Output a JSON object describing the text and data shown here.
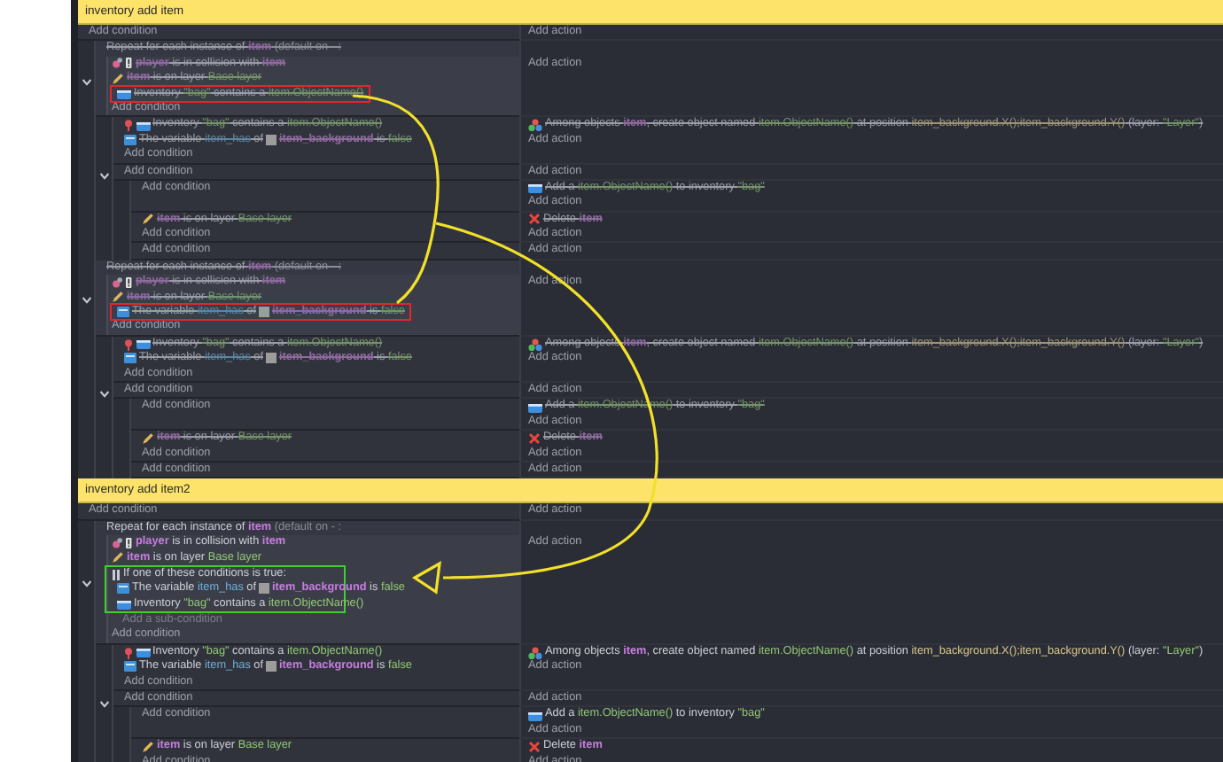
{
  "events": [
    {
      "kind": "comment",
      "text": "inventory add item"
    },
    {
      "kind": "standard",
      "add_condition": "Add condition",
      "add_action": "Add action",
      "children": [
        {
          "kind": "repeat",
          "disabled": true,
          "expanded": true,
          "header": [
            {
              "kind": "plain",
              "text": "Repeat for each instance of "
            },
            {
              "kind": "object",
              "text": "item"
            },
            {
              "kind": "note",
              "text": " (default on - :"
            }
          ],
          "conditions": [
            {
              "kind": "collision",
              "parts": [
                {
                  "kind": "object",
                  "text": "player"
                },
                {
                  "kind": "plain",
                  "text": " is in collision with "
                },
                {
                  "kind": "object",
                  "text": "item"
                }
              ]
            },
            {
              "kind": "layer",
              "parts": [
                {
                  "kind": "object",
                  "text": "item"
                },
                {
                  "kind": "plain",
                  "text": " is on layer "
                },
                {
                  "kind": "value",
                  "text": "Base layer"
                }
              ]
            },
            {
              "kind": "inventory",
              "color": "#e3262b",
              "parts": [
                {
                  "kind": "plain",
                  "text": "Inventory "
                },
                {
                  "kind": "value",
                  "text": "\"bag\""
                },
                {
                  "kind": "plain",
                  "text": " contains a "
                },
                {
                  "kind": "value",
                  "text": "item.ObjectName()"
                }
              ]
            }
          ],
          "add_condition": "Add condition",
          "add_action": "Add action",
          "children": [
            {
              "kind": "standard",
              "disabled": true,
              "conditions": [
                {
                  "kind": "inventory-once",
                  "parts": [
                    {
                      "kind": "plain",
                      "text": "Inventory "
                    },
                    {
                      "kind": "value",
                      "text": "\"bag\""
                    },
                    {
                      "kind": "plain",
                      "text": " contains a "
                    },
                    {
                      "kind": "value",
                      "text": "item.ObjectName()"
                    }
                  ]
                },
                {
                  "kind": "variable",
                  "parts": [
                    {
                      "kind": "plain",
                      "text": "The variable "
                    },
                    {
                      "kind": "variable",
                      "text": "item_has"
                    },
                    {
                      "kind": "plain",
                      "text": " of "
                    },
                    {
                      "kind": "object",
                      "text": "item_background",
                      "thumbnail": true
                    },
                    {
                      "kind": "plain",
                      "text": " is "
                    },
                    {
                      "kind": "value",
                      "text": "false"
                    }
                  ]
                }
              ],
              "add_condition": "Add condition",
              "actions": [
                {
                  "kind": "create",
                  "parts": [
                    {
                      "kind": "plain",
                      "text": "Among objects "
                    },
                    {
                      "kind": "object",
                      "text": "item"
                    },
                    {
                      "kind": "plain",
                      "text": ", create object named "
                    },
                    {
                      "kind": "value",
                      "text": "item.ObjectName()"
                    },
                    {
                      "kind": "plain",
                      "text": " at position "
                    },
                    {
                      "kind": "number",
                      "text": "item_background.X();item_background.Y()"
                    },
                    {
                      "kind": "plain",
                      "text": " (layer: "
                    },
                    {
                      "kind": "value",
                      "text": "\"Layer\""
                    },
                    {
                      "kind": "plain",
                      "text": ")"
                    }
                  ]
                }
              ],
              "add_action": "Add action"
            },
            {
              "kind": "standard",
              "disabled": true,
              "expanded": true,
              "add_condition": "Add condition",
              "add_action": "Add action",
              "children": [
                {
                  "kind": "standard",
                  "disabled": true,
                  "add_condition": "Add condition",
                  "actions": [
                    {
                      "kind": "inventory",
                      "parts": [
                        {
                          "kind": "plain",
                          "text": "Add a "
                        },
                        {
                          "kind": "value",
                          "text": "item.ObjectName()"
                        },
                        {
                          "kind": "plain",
                          "text": " to inventory "
                        },
                        {
                          "kind": "value",
                          "text": "\"bag\""
                        }
                      ]
                    }
                  ],
                  "add_action": "Add action"
                },
                {
                  "kind": "standard",
                  "disabled": true,
                  "conditions": [
                    {
                      "kind": "layer",
                      "parts": [
                        {
                          "kind": "object",
                          "text": "item"
                        },
                        {
                          "kind": "plain",
                          "text": " is on layer "
                        },
                        {
                          "kind": "value",
                          "text": "Base layer"
                        }
                      ]
                    }
                  ],
                  "add_condition": "Add condition",
                  "actions": [
                    {
                      "kind": "delete",
                      "parts": [
                        {
                          "kind": "plain",
                          "text": "Delete "
                        },
                        {
                          "kind": "object",
                          "text": "item"
                        }
                      ]
                    }
                  ],
                  "add_action": "Add action"
                },
                {
                  "kind": "standard",
                  "disabled": true,
                  "add_condition": "Add condition",
                  "add_action": "Add action"
                }
              ]
            }
          ]
        },
        {
          "kind": "repeat",
          "disabled": true,
          "expanded": true,
          "header": [
            {
              "kind": "plain",
              "text": "Repeat for each instance of "
            },
            {
              "kind": "object",
              "text": "item"
            },
            {
              "kind": "note",
              "text": " (default on - :"
            }
          ],
          "conditions": [
            {
              "kind": "collision",
              "parts": [
                {
                  "kind": "object",
                  "text": "player"
                },
                {
                  "kind": "plain",
                  "text": " is in collision with "
                },
                {
                  "kind": "object",
                  "text": "item"
                }
              ]
            },
            {
              "kind": "layer",
              "parts": [
                {
                  "kind": "object",
                  "text": "item"
                },
                {
                  "kind": "plain",
                  "text": " is on layer "
                },
                {
                  "kind": "value",
                  "text": "Base layer"
                }
              ]
            },
            {
              "kind": "variable",
              "color": "#e3262b",
              "parts": [
                {
                  "kind": "plain",
                  "text": "The variable "
                },
                {
                  "kind": "variable",
                  "text": "item_has"
                },
                {
                  "kind": "plain",
                  "text": " of "
                },
                {
                  "kind": "object",
                  "text": "item_background",
                  "thumbnail": true
                },
                {
                  "kind": "plain",
                  "text": " is "
                },
                {
                  "kind": "value",
                  "text": "false"
                }
              ]
            }
          ],
          "add_condition": "Add condition",
          "add_action": "Add action",
          "children": [
            {
              "kind": "standard",
              "disabled": true,
              "conditions": [
                {
                  "kind": "inventory-once",
                  "parts": [
                    {
                      "kind": "plain",
                      "text": "Inventory "
                    },
                    {
                      "kind": "value",
                      "text": "\"bag\""
                    },
                    {
                      "kind": "plain",
                      "text": " contains a "
                    },
                    {
                      "kind": "value",
                      "text": "item.ObjectName()"
                    }
                  ]
                },
                {
                  "kind": "variable",
                  "parts": [
                    {
                      "kind": "plain",
                      "text": "The variable "
                    },
                    {
                      "kind": "variable",
                      "text": "item_has"
                    },
                    {
                      "kind": "plain",
                      "text": " of "
                    },
                    {
                      "kind": "object",
                      "text": "item_background",
                      "thumbnail": true
                    },
                    {
                      "kind": "plain",
                      "text": " is "
                    },
                    {
                      "kind": "value",
                      "text": "false"
                    }
                  ]
                }
              ],
              "add_condition": "Add condition",
              "actions": [
                {
                  "kind": "create",
                  "parts": [
                    {
                      "kind": "plain",
                      "text": "Among objects "
                    },
                    {
                      "kind": "object",
                      "text": "item"
                    },
                    {
                      "kind": "plain",
                      "text": ", create object named "
                    },
                    {
                      "kind": "value",
                      "text": "item.ObjectName()"
                    },
                    {
                      "kind": "plain",
                      "text": " at position "
                    },
                    {
                      "kind": "number",
                      "text": "item_background.X();item_background.Y()"
                    },
                    {
                      "kind": "plain",
                      "text": " (layer: "
                    },
                    {
                      "kind": "value",
                      "text": "\"Layer\""
                    },
                    {
                      "kind": "plain",
                      "text": ")"
                    }
                  ]
                }
              ],
              "add_action": "Add action"
            },
            {
              "kind": "standard",
              "disabled": true,
              "expanded": true,
              "add_condition": "Add condition",
              "add_action": "Add action",
              "children": [
                {
                  "kind": "standard",
                  "disabled": true,
                  "add_condition": "Add condition",
                  "actions": [
                    {
                      "kind": "inventory",
                      "parts": [
                        {
                          "kind": "plain",
                          "text": "Add a "
                        },
                        {
                          "kind": "value",
                          "text": "item.ObjectName()"
                        },
                        {
                          "kind": "plain",
                          "text": " to inventory "
                        },
                        {
                          "kind": "value",
                          "text": "\"bag\""
                        }
                      ]
                    }
                  ],
                  "add_action": "Add action"
                },
                {
                  "kind": "standard",
                  "disabled": true,
                  "conditions": [
                    {
                      "kind": "layer",
                      "parts": [
                        {
                          "kind": "object",
                          "text": "item"
                        },
                        {
                          "kind": "plain",
                          "text": " is on layer "
                        },
                        {
                          "kind": "value",
                          "text": "Base layer"
                        }
                      ]
                    }
                  ],
                  "add_condition": "Add condition",
                  "actions": [
                    {
                      "kind": "delete",
                      "parts": [
                        {
                          "kind": "plain",
                          "text": "Delete "
                        },
                        {
                          "kind": "object",
                          "text": "item"
                        }
                      ]
                    }
                  ],
                  "add_action": "Add action"
                },
                {
                  "kind": "standard",
                  "disabled": true,
                  "add_condition": "Add condition",
                  "add_action": "Add action"
                }
              ]
            }
          ]
        }
      ]
    },
    {
      "kind": "comment",
      "text": "inventory add item2"
    },
    {
      "kind": "standard",
      "add_condition": "Add condition",
      "add_action": "Add action",
      "children": [
        {
          "kind": "repeat",
          "disabled": false,
          "expanded": true,
          "header": [
            {
              "kind": "plain",
              "text": "Repeat for each instance of "
            },
            {
              "kind": "object",
              "text": "item"
            },
            {
              "kind": "note",
              "text": " (default on - :"
            }
          ],
          "conditions": [
            {
              "kind": "collision",
              "parts": [
                {
                  "kind": "object",
                  "text": "player"
                },
                {
                  "kind": "plain",
                  "text": " is in collision with "
                },
                {
                  "kind": "object",
                  "text": "item"
                }
              ]
            },
            {
              "kind": "layer",
              "parts": [
                {
                  "kind": "object",
                  "text": "item"
                },
                {
                  "kind": "plain",
                  "text": " is on layer "
                },
                {
                  "kind": "value",
                  "text": "Base layer"
                }
              ]
            },
            {
              "kind": "or",
              "color": "#3fcf2e",
              "parts": [
                {
                  "kind": "plain",
                  "text": "If one of these conditions is true:"
                }
              ],
              "conditions": [
                {
                  "kind": "variable",
                  "parts": [
                    {
                      "kind": "plain",
                      "text": "The variable "
                    },
                    {
                      "kind": "variable",
                      "text": "item_has"
                    },
                    {
                      "kind": "plain",
                      "text": " of "
                    },
                    {
                      "kind": "object",
                      "text": "item_background",
                      "thumbnail": true
                    },
                    {
                      "kind": "plain",
                      "text": " is "
                    },
                    {
                      "kind": "value",
                      "text": "false"
                    }
                  ]
                },
                {
                  "kind": "inventory",
                  "parts": [
                    {
                      "kind": "plain",
                      "text": "Inventory "
                    },
                    {
                      "kind": "value",
                      "text": "\"bag\""
                    },
                    {
                      "kind": "plain",
                      "text": " contains a "
                    },
                    {
                      "kind": "value",
                      "text": "item.ObjectName()"
                    }
                  ]
                }
              ],
              "add_subcondition": "Add a sub-condition"
            }
          ],
          "add_condition": "Add condition",
          "add_action": "Add action",
          "children": [
            {
              "kind": "standard",
              "disabled": false,
              "conditions": [
                {
                  "kind": "inventory-once",
                  "parts": [
                    {
                      "kind": "plain",
                      "text": "Inventory "
                    },
                    {
                      "kind": "value",
                      "text": "\"bag\""
                    },
                    {
                      "kind": "plain",
                      "text": " contains a "
                    },
                    {
                      "kind": "value",
                      "text": "item.ObjectName()"
                    }
                  ]
                },
                {
                  "kind": "variable",
                  "parts": [
                    {
                      "kind": "plain",
                      "text": "The variable "
                    },
                    {
                      "kind": "variable",
                      "text": "item_has"
                    },
                    {
                      "kind": "plain",
                      "text": " of "
                    },
                    {
                      "kind": "object",
                      "text": "item_background",
                      "thumbnail": true
                    },
                    {
                      "kind": "plain",
                      "text": " is "
                    },
                    {
                      "kind": "value",
                      "text": "false"
                    }
                  ]
                }
              ],
              "add_condition": "Add condition",
              "actions": [
                {
                  "kind": "create",
                  "parts": [
                    {
                      "kind": "plain",
                      "text": "Among objects "
                    },
                    {
                      "kind": "object",
                      "text": "item"
                    },
                    {
                      "kind": "plain",
                      "text": ", create object named "
                    },
                    {
                      "kind": "value",
                      "text": "item.ObjectName()"
                    },
                    {
                      "kind": "plain",
                      "text": " at position "
                    },
                    {
                      "kind": "number",
                      "text": "item_background.X();item_background.Y()"
                    },
                    {
                      "kind": "plain",
                      "text": " (layer: "
                    },
                    {
                      "kind": "value",
                      "text": "\"Layer\""
                    },
                    {
                      "kind": "plain",
                      "text": ")"
                    }
                  ]
                }
              ],
              "add_action": "Add action"
            },
            {
              "kind": "standard",
              "disabled": false,
              "expanded": true,
              "add_condition": "Add condition",
              "add_action": "Add action",
              "children": [
                {
                  "kind": "standard",
                  "disabled": false,
                  "add_condition": "Add condition",
                  "actions": [
                    {
                      "kind": "inventory",
                      "parts": [
                        {
                          "kind": "plain",
                          "text": "Add a "
                        },
                        {
                          "kind": "value",
                          "text": "item.ObjectName()"
                        },
                        {
                          "kind": "plain",
                          "text": " to inventory "
                        },
                        {
                          "kind": "value",
                          "text": "\"bag\""
                        }
                      ]
                    }
                  ],
                  "add_action": "Add action"
                },
                {
                  "kind": "standard",
                  "disabled": false,
                  "conditions": [
                    {
                      "kind": "layer",
                      "parts": [
                        {
                          "kind": "object",
                          "text": "item"
                        },
                        {
                          "kind": "plain",
                          "text": " is on layer "
                        },
                        {
                          "kind": "value",
                          "text": "Base layer"
                        }
                      ]
                    }
                  ],
                  "add_condition": "Add condition",
                  "actions": [
                    {
                      "kind": "delete",
                      "parts": [
                        {
                          "kind": "plain",
                          "text": "Delete "
                        },
                        {
                          "kind": "object",
                          "text": "item"
                        }
                      ]
                    }
                  ],
                  "add_action": "Add action"
                }
              ]
            }
          ]
        }
      ]
    }
  ]
}
